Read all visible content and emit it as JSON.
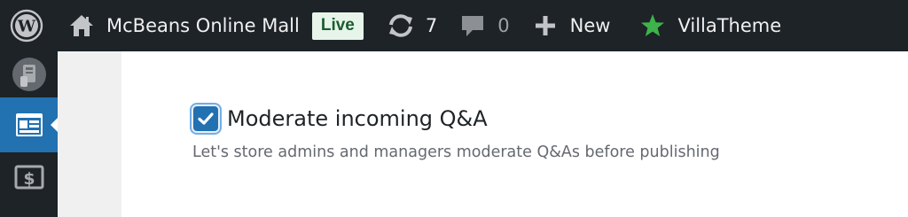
{
  "admin_bar": {
    "wp_logo_icon": "wordpress-logo-icon",
    "site_name": "McBeans Online Mall",
    "site_icon": "home-icon",
    "live_badge": "Live",
    "updates_count": "7",
    "updates_icon": "updates-refresh-icon",
    "comments_count": "0",
    "comments_icon": "comment-bubble-icon",
    "new_label": "New",
    "new_icon": "plus-icon",
    "theme_label": "VillaTheme",
    "theme_icon": "star-icon",
    "star_color": "#3db34a"
  },
  "sidebar": {
    "items": [
      {
        "icon": "plugin-avatar-icon"
      },
      {
        "icon": "product-table-icon",
        "active": true
      },
      {
        "icon": "dollar-icon"
      }
    ],
    "active_color": "#2271b1"
  },
  "setting": {
    "checked": true,
    "label": "Moderate incoming Q&A",
    "description": "Let's store admins and managers moderate Q&As before publishing"
  }
}
